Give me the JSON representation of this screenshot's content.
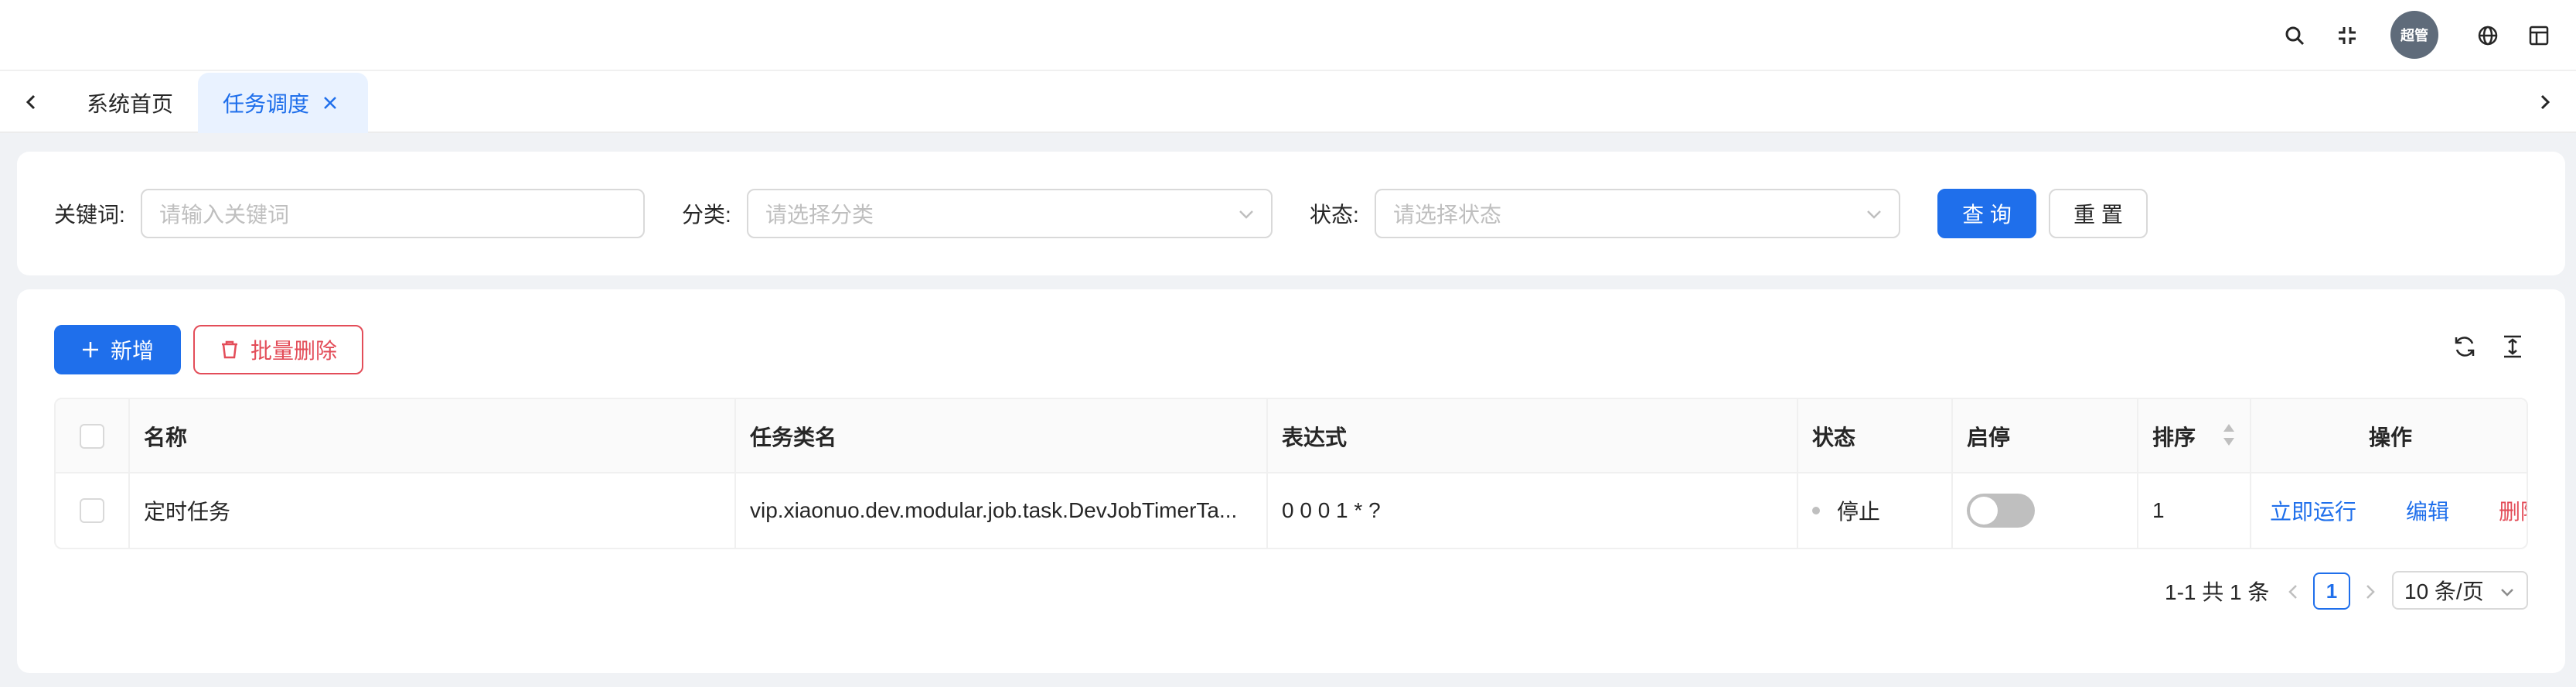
{
  "header": {
    "avatar_text": "超管",
    "icons": [
      "search-icon",
      "fullscreen-exit-icon",
      "globe-icon",
      "layout-icon"
    ]
  },
  "tabs": {
    "items": [
      {
        "label": "系统首页"
      },
      {
        "label": "任务调度"
      }
    ]
  },
  "search": {
    "keyword_label": "关键词:",
    "keyword_placeholder": "请输入关键词",
    "category_label": "分类:",
    "category_placeholder": "请选择分类",
    "status_label": "状态:",
    "status_placeholder": "请选择状态",
    "query_button": "查 询",
    "reset_button": "重 置"
  },
  "toolbar": {
    "add_button": "新增",
    "batch_delete_button": "批量删除"
  },
  "table": {
    "columns": [
      "名称",
      "任务类名",
      "表达式",
      "状态",
      "启停",
      "排序",
      "操作"
    ],
    "rows": [
      {
        "name": "定时任务",
        "class_name": "vip.xiaonuo.dev.modular.job.task.DevJobTimerTa...",
        "expression": "0 0 0 1 * ?",
        "status": "停止",
        "enabled": false,
        "sort": "1",
        "actions": {
          "run": "立即运行",
          "edit": "编辑",
          "delete": "删除"
        }
      }
    ]
  },
  "pagination": {
    "total_text": "1-1 共 1 条",
    "current_page": "1",
    "page_size": "10 条/页"
  },
  "colors": {
    "primary": "#1f6feb",
    "danger": "#e34d59"
  }
}
